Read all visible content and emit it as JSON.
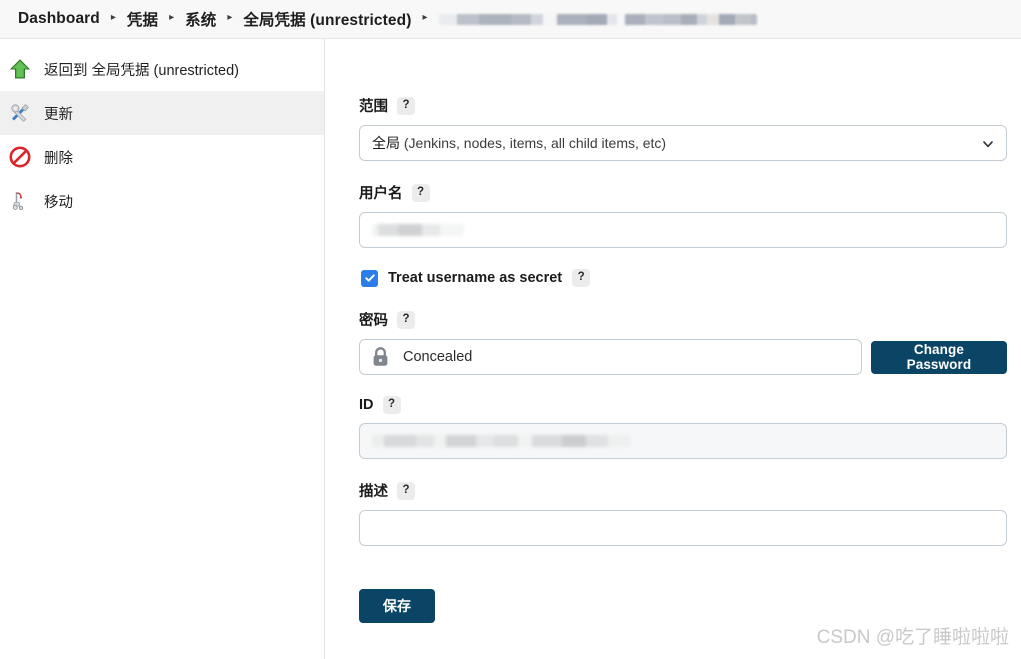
{
  "breadcrumb": {
    "items": [
      {
        "label": "Dashboard",
        "redacted": false
      },
      {
        "label": "凭据",
        "redacted": false
      },
      {
        "label": "系统",
        "redacted": false
      },
      {
        "label": "全局凭据 (unrestricted)",
        "redacted": false
      }
    ],
    "separator": "▸",
    "trailing_redacted": true
  },
  "sidebar": {
    "items": [
      {
        "label": "返回到 全局凭据 (unrestricted)",
        "icon": "up-arrow-icon",
        "active": false
      },
      {
        "label": "更新",
        "icon": "tools-icon",
        "active": true
      },
      {
        "label": "删除",
        "icon": "no-entry-icon",
        "active": false
      },
      {
        "label": "移动",
        "icon": "crane-icon",
        "active": false
      }
    ]
  },
  "form": {
    "help_glyph": "?",
    "scope": {
      "label": "范围",
      "value_bold": "全局",
      "value_rest": " (Jenkins, nodes, items, all child items, etc)",
      "value": "全局 (Jenkins, nodes, items, all child items, etc)"
    },
    "username": {
      "label": "用户名",
      "value": "",
      "redacted": true
    },
    "treat_secret": {
      "label": "Treat username as secret",
      "checked": true
    },
    "password": {
      "label": "密码",
      "value": "Concealed",
      "change_button": "Change Password"
    },
    "id": {
      "label": "ID",
      "value": "",
      "redacted": true,
      "disabled": true
    },
    "description": {
      "label": "描述",
      "value": "",
      "placeholder": ""
    },
    "save_button": "保存"
  },
  "watermark": "CSDN @吃了睡啦啦啦",
  "colors": {
    "accent_button": "#0b4566",
    "checkbox_blue": "#2b7de9",
    "sidebar_active": "#f0f0f0",
    "header_bg": "#f8f8f8",
    "border": "#c5cdd4"
  }
}
